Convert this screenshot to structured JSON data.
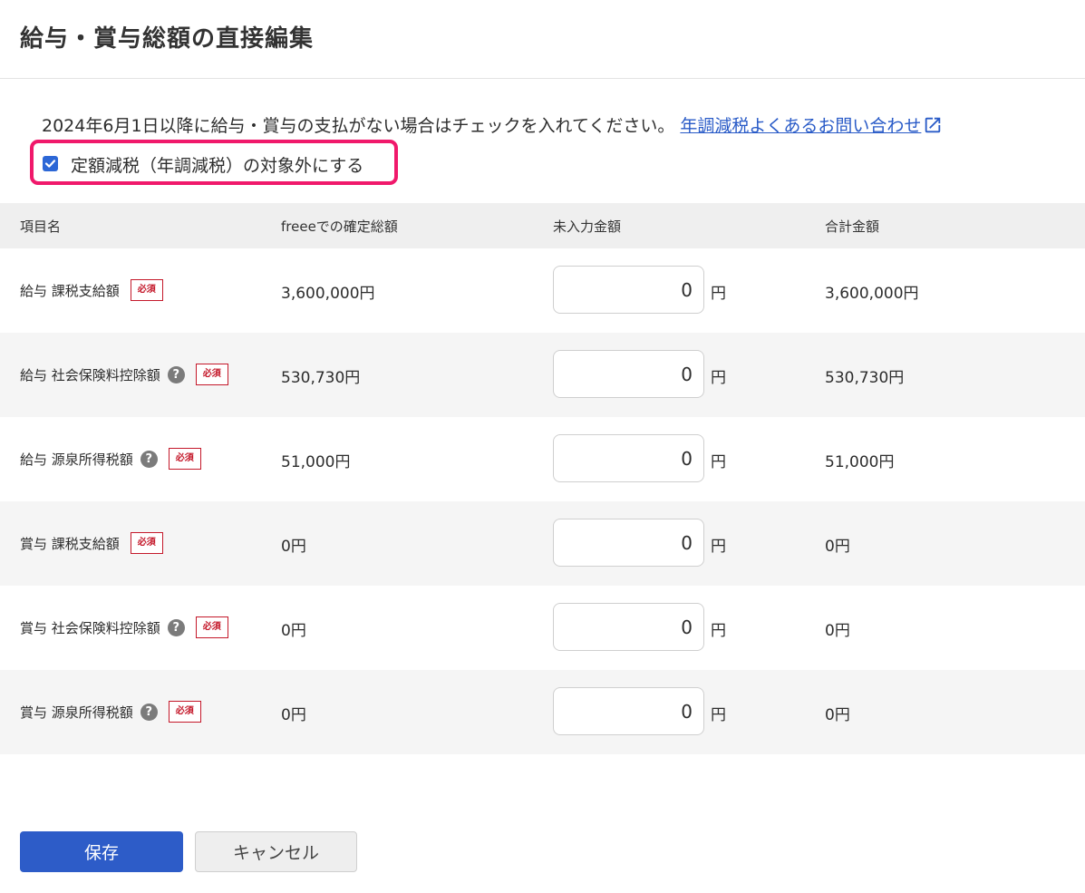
{
  "page": {
    "title": "給与・賞与総額の直接編集"
  },
  "notice": {
    "text": "2024年6月1日以降に給与・賞与の支払がない場合はチェックを入れてください。",
    "link_label": "年調減税よくあるお問い合わせ",
    "link_icon": "external-link-icon"
  },
  "checkbox": {
    "label": "定額減税（年調減税）の対象外にする",
    "checked": true
  },
  "table": {
    "headers": [
      "項目名",
      "freeeでの確定総額",
      "未入力金額",
      "合計金額"
    ],
    "rows": [
      {
        "name": "給与 課税支給額",
        "help": false,
        "badge": "必須",
        "confirmed": "3,600,000円",
        "input": "0",
        "unit": "円",
        "total": "3,600,000円"
      },
      {
        "name": "給与 社会保険料控除額",
        "help": true,
        "help_icon": "?",
        "badge": "必須",
        "confirmed": "530,730円",
        "input": "0",
        "unit": "円",
        "total": "530,730円"
      },
      {
        "name": "給与 源泉所得税額",
        "help": true,
        "help_icon": "?",
        "badge": "必須",
        "confirmed": "51,000円",
        "input": "0",
        "unit": "円",
        "total": "51,000円"
      },
      {
        "name": "賞与 課税支給額",
        "help": false,
        "badge": "必須",
        "confirmed": "0円",
        "input": "0",
        "unit": "円",
        "total": "0円"
      },
      {
        "name": "賞与 社会保険料控除額",
        "help": true,
        "help_icon": "?",
        "badge": "必須",
        "confirmed": "0円",
        "input": "0",
        "unit": "円",
        "total": "0円"
      },
      {
        "name": "賞与 源泉所得税額",
        "help": true,
        "help_icon": "?",
        "badge": "必須",
        "confirmed": "0円",
        "input": "0",
        "unit": "円",
        "total": "0円"
      }
    ]
  },
  "buttons": {
    "save": "保存",
    "cancel": "キャンセル"
  },
  "colors": {
    "primary": "#2d5cc8",
    "link": "#285ac7",
    "highlight": "#f0196b",
    "required": "#c4182a"
  }
}
